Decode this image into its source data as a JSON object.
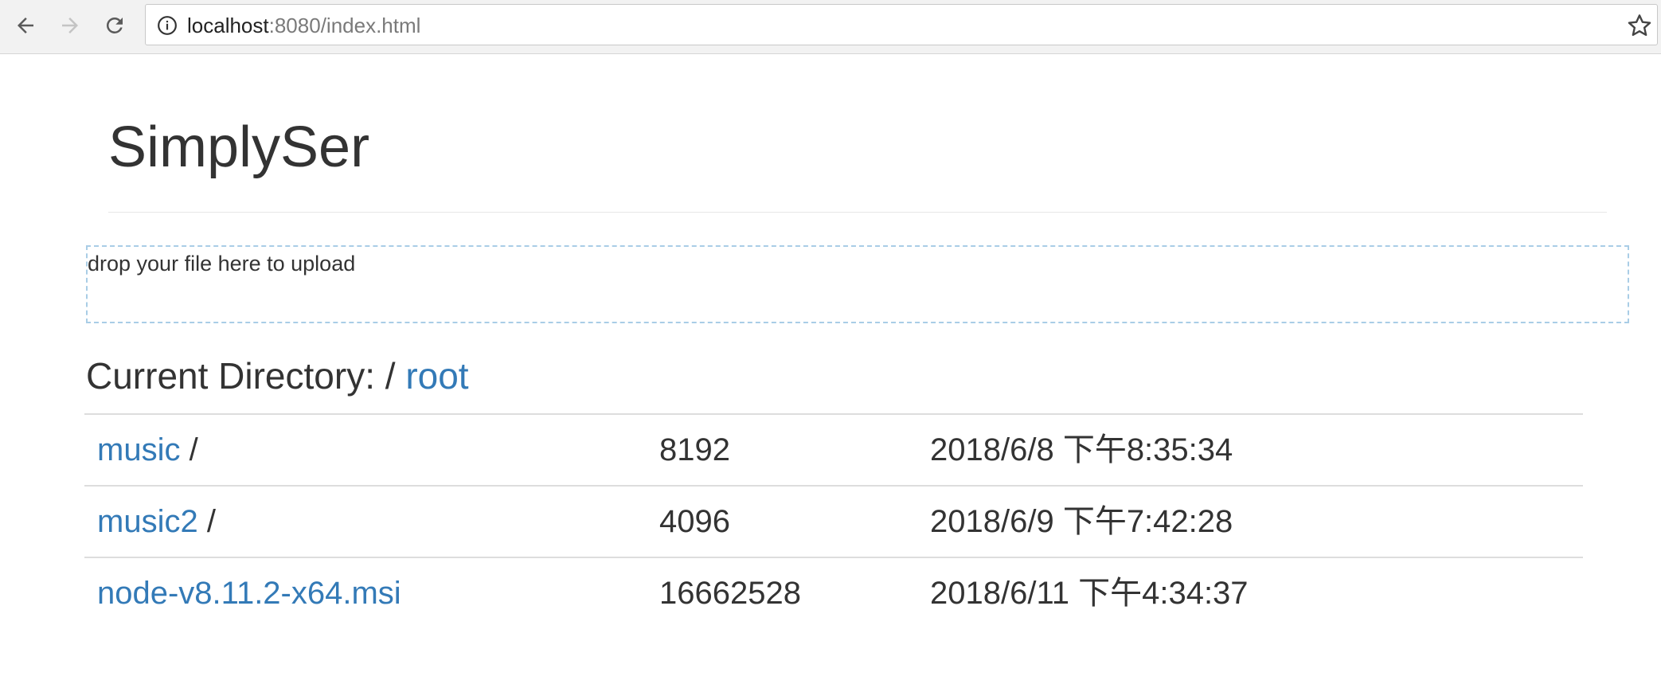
{
  "browser": {
    "url_host": "localhost",
    "url_rest": ":8080/index.html"
  },
  "page": {
    "title": "SimplySer",
    "drop_text": "drop your file here to upload",
    "current_dir_label": "Current Directory: / ",
    "current_dir_link": "root",
    "dir_separator": "/"
  },
  "files": [
    {
      "name": "music",
      "is_dir": true,
      "size": "8192",
      "date": "2018/6/8 下午8:35:34"
    },
    {
      "name": "music2",
      "is_dir": true,
      "size": "4096",
      "date": "2018/6/9 下午7:42:28"
    },
    {
      "name": "node-v8.11.2-x64.msi",
      "is_dir": false,
      "size": "16662528",
      "date": "2018/6/11 下午4:34:37"
    }
  ],
  "colors": {
    "link": "#337ab7",
    "text": "#333333",
    "drop_border": "#a9cde6"
  },
  "icons": {
    "back": "back-arrow-icon",
    "forward": "forward-arrow-icon",
    "reload": "reload-icon",
    "info": "info-icon",
    "bookmark": "star-icon"
  }
}
